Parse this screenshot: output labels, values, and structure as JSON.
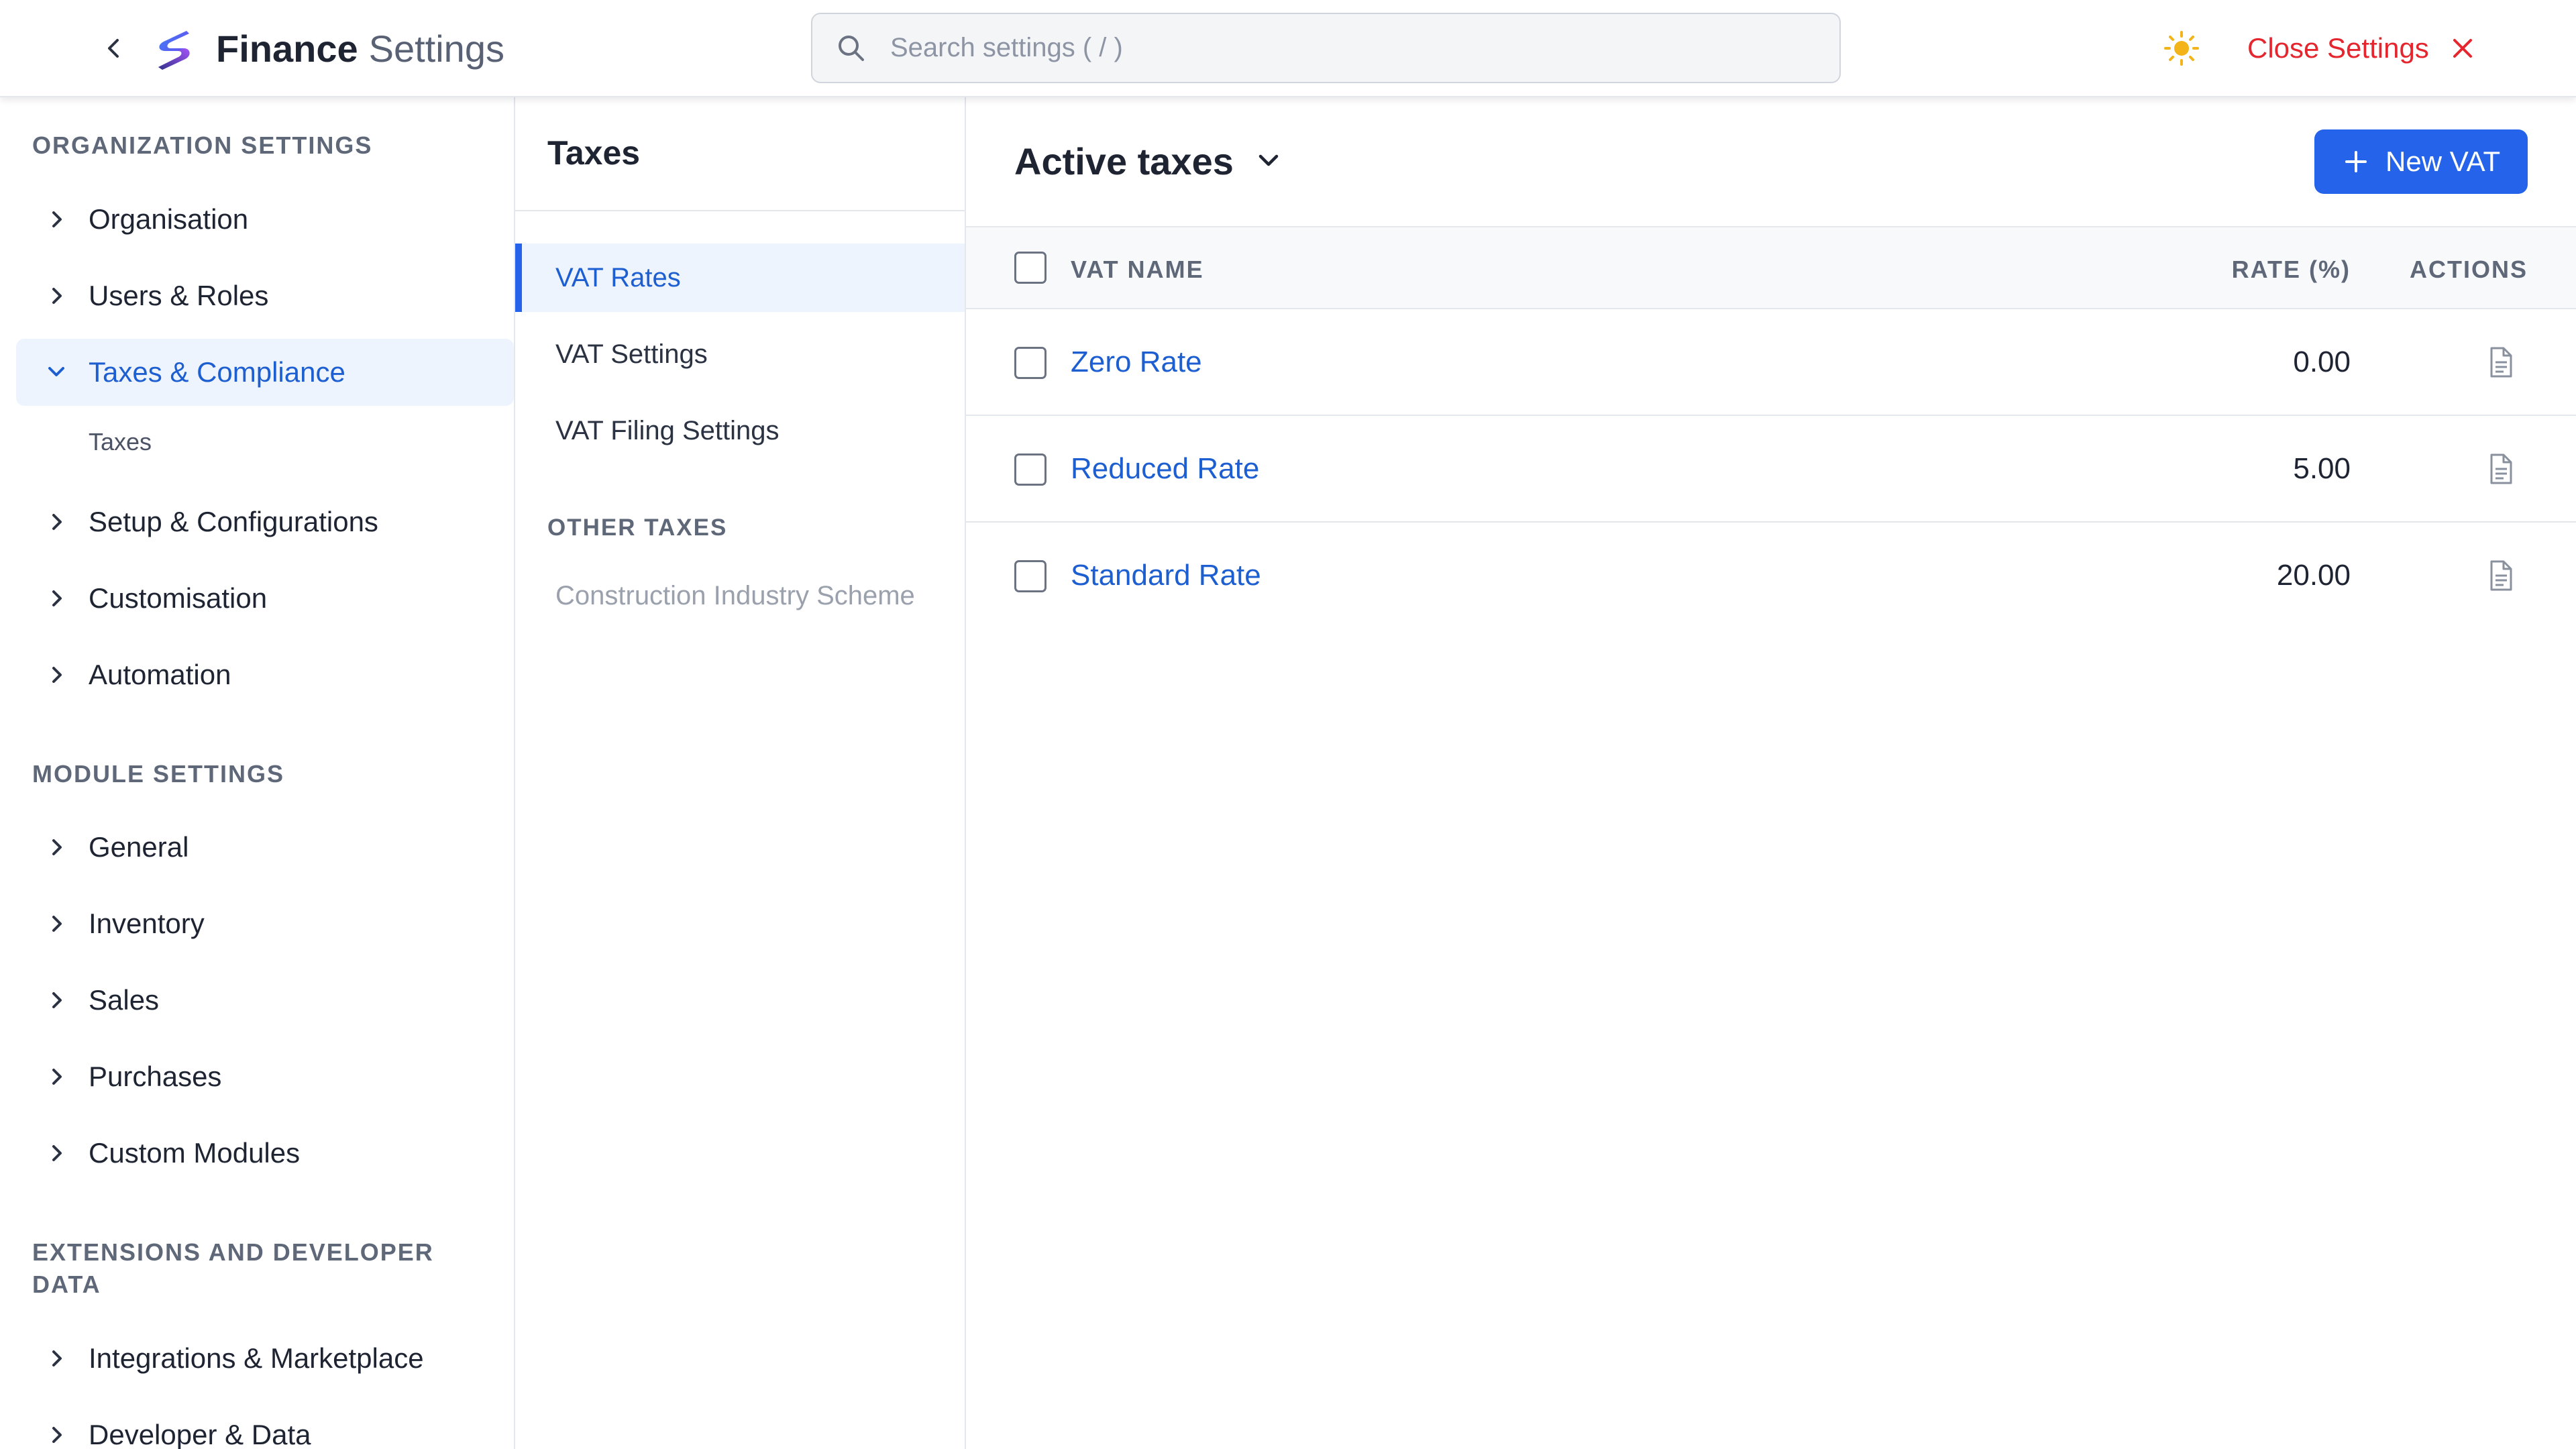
{
  "header": {
    "title_strong": "Finance",
    "title_light": "Settings",
    "search_placeholder": "Search settings ( / )",
    "close_label": "Close Settings"
  },
  "sidebar": {
    "sections": [
      {
        "title": "ORGANIZATION SETTINGS",
        "items": [
          {
            "label": "Organisation",
            "expanded": false
          },
          {
            "label": "Users & Roles",
            "expanded": false
          },
          {
            "label": "Taxes & Compliance",
            "expanded": true,
            "active": true,
            "children": [
              "Taxes"
            ]
          },
          {
            "label": "Setup & Configurations",
            "expanded": false
          },
          {
            "label": "Customisation",
            "expanded": false
          },
          {
            "label": "Automation",
            "expanded": false
          }
        ]
      },
      {
        "title": "MODULE SETTINGS",
        "items": [
          {
            "label": "General"
          },
          {
            "label": "Inventory"
          },
          {
            "label": "Sales"
          },
          {
            "label": "Purchases"
          },
          {
            "label": "Custom Modules"
          }
        ]
      },
      {
        "title_line1": "EXTENSIONS AND DEVELOPER",
        "title_line2": "DATA",
        "items": [
          {
            "label": "Integrations & Marketplace"
          },
          {
            "label": "Developer & Data"
          }
        ]
      }
    ]
  },
  "middle": {
    "title": "Taxes",
    "items": [
      {
        "label": "VAT Rates",
        "active": true
      },
      {
        "label": "VAT Settings"
      },
      {
        "label": "VAT Filing Settings"
      }
    ],
    "other_title": "OTHER TAXES",
    "other_items": [
      {
        "label": "Construction Industry Scheme",
        "disabled": true
      }
    ]
  },
  "main": {
    "view_label": "Active taxes",
    "new_button": "New VAT",
    "columns": [
      "VAT NAME",
      "RATE (%)",
      "ACTIONS"
    ],
    "rows": [
      {
        "name": "Zero Rate",
        "rate": "0.00",
        "action_icon": "document-icon"
      },
      {
        "name": "Reduced Rate",
        "rate": "5.00",
        "action_icon": "document-icon"
      },
      {
        "name": "Standard Rate",
        "rate": "20.00",
        "action_icon": "document-icon"
      }
    ]
  },
  "colors": {
    "accent": "#2563eb",
    "link": "#1d5fd1",
    "danger": "#e5262e",
    "sun": "#f2b418",
    "active_bg": "#eef4fd"
  },
  "icons": [
    "chevron-left-icon",
    "app-logo",
    "search-icon",
    "sun-icon",
    "close-icon",
    "chevron-right-icon",
    "chevron-down-icon",
    "plus-icon",
    "document-icon"
  ]
}
